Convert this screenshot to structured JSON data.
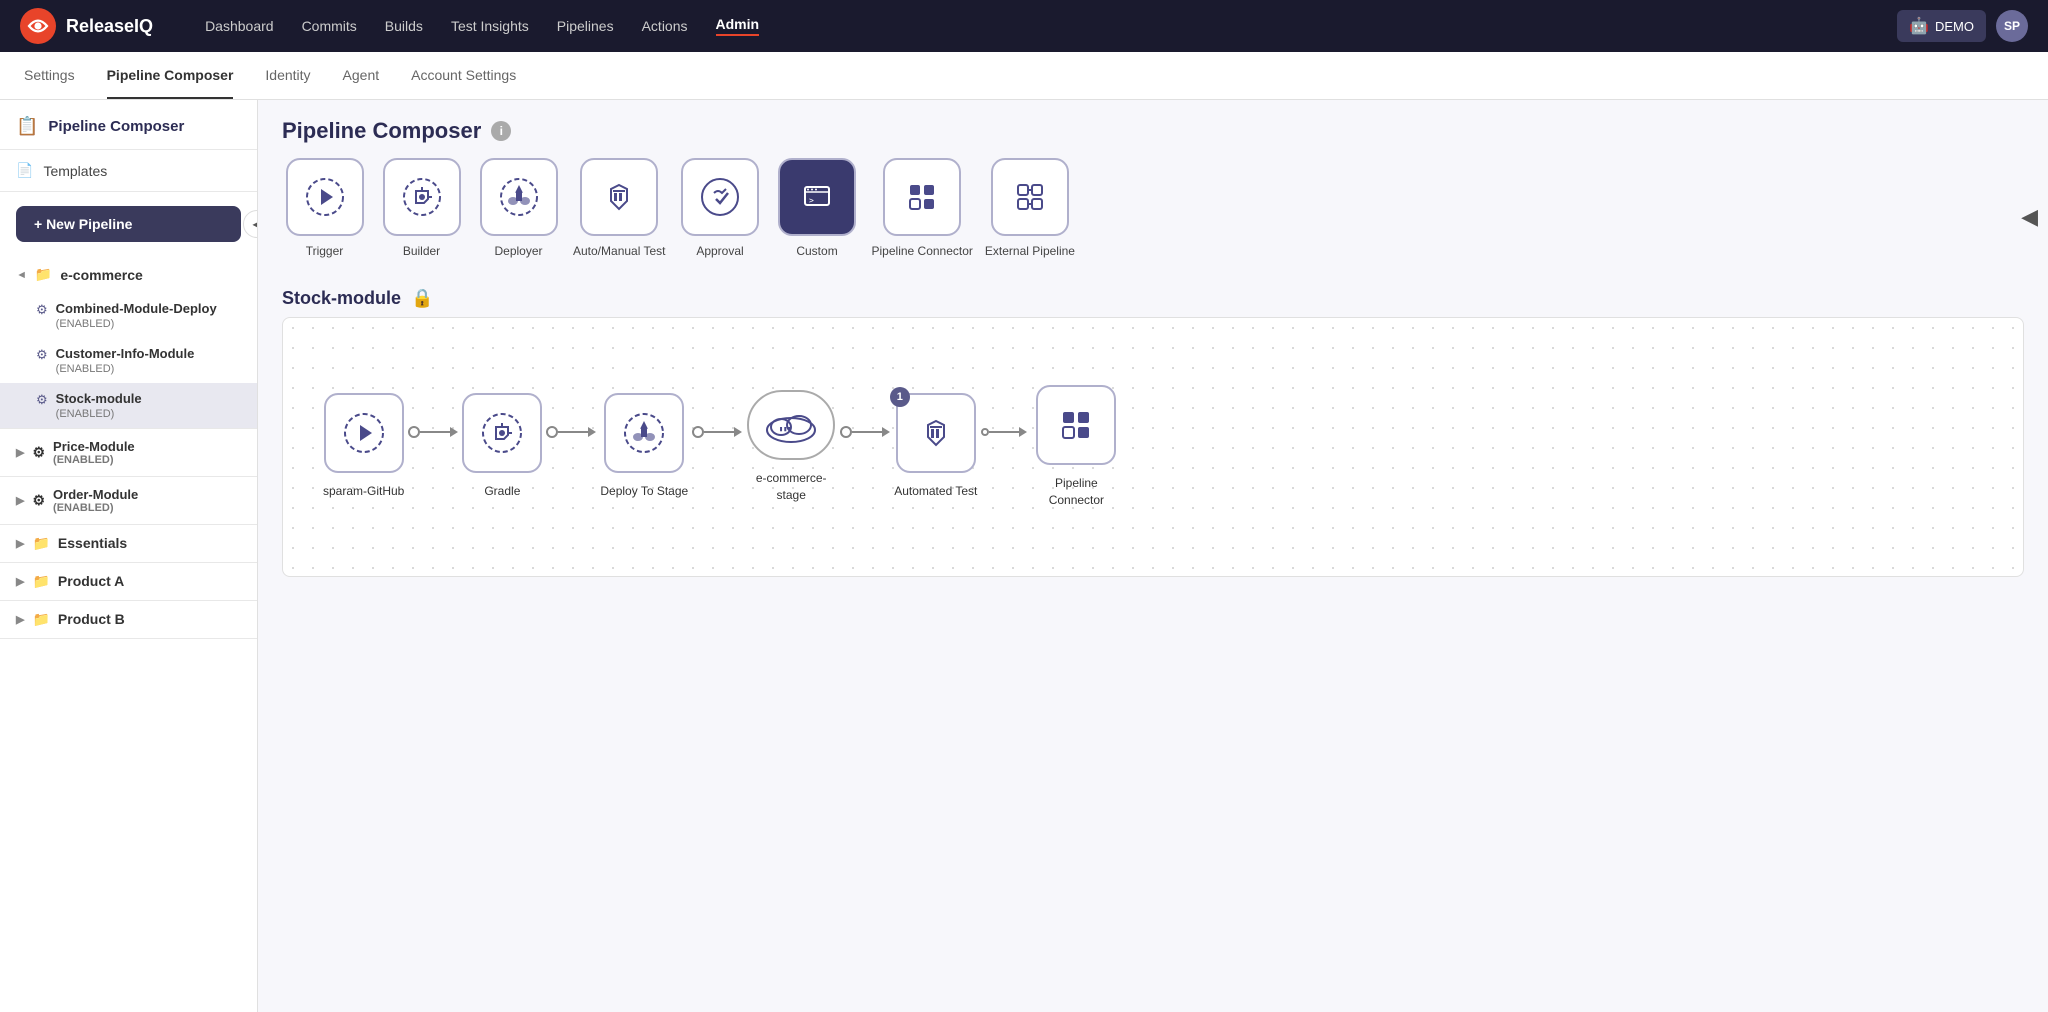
{
  "brand": {
    "name": "ReleaseIQ"
  },
  "topNav": {
    "links": [
      {
        "label": "Dashboard",
        "active": false
      },
      {
        "label": "Commits",
        "active": false
      },
      {
        "label": "Builds",
        "active": false
      },
      {
        "label": "Test Insights",
        "active": false
      },
      {
        "label": "Pipelines",
        "active": false
      },
      {
        "label": "Actions",
        "active": false
      },
      {
        "label": "Admin",
        "active": true
      }
    ],
    "demo_label": "DEMO",
    "avatar_label": "SP"
  },
  "subNav": {
    "items": [
      {
        "label": "Settings",
        "active": false
      },
      {
        "label": "Pipeline Composer",
        "active": true
      },
      {
        "label": "Identity",
        "active": false
      },
      {
        "label": "Agent",
        "active": false
      },
      {
        "label": "Account Settings",
        "active": false
      }
    ]
  },
  "sidebar": {
    "title": "Pipeline Composer",
    "templates_label": "Templates",
    "new_pipeline_label": "+ New Pipeline",
    "groups": [
      {
        "name": "e-commerce",
        "open": true,
        "pipelines": [
          {
            "name": "Combined-Module-Deploy",
            "status": "(ENABLED)",
            "active": false
          },
          {
            "name": "Customer-Info-Module",
            "status": "(ENABLED)",
            "active": false
          },
          {
            "name": "Stock-module",
            "status": "(ENABLED)",
            "active": true
          }
        ]
      },
      {
        "name": "Price-Module",
        "status": "(ENABLED)",
        "open": false,
        "pipelines": []
      },
      {
        "name": "Order-Module",
        "status": "(ENABLED)",
        "open": false,
        "pipelines": []
      },
      {
        "name": "Essentials",
        "open": false,
        "pipelines": []
      },
      {
        "name": "Product A",
        "open": false,
        "pipelines": []
      },
      {
        "name": "Product B",
        "open": false,
        "pipelines": []
      }
    ]
  },
  "content": {
    "title": "Pipeline Composer",
    "pipeline_name": "Stock-module",
    "stageIcons": [
      {
        "label": "Trigger",
        "icon": "⚡"
      },
      {
        "label": "Builder",
        "icon": "⚙"
      },
      {
        "label": "Deployer",
        "icon": "🚀"
      },
      {
        "label": "Auto/Manual Test",
        "icon": "🧪"
      },
      {
        "label": "Approval",
        "icon": "✅"
      },
      {
        "label": "Custom",
        "icon": "💻"
      },
      {
        "label": "Pipeline Connector",
        "icon": "🔲"
      },
      {
        "label": "External Pipeline",
        "icon": "⊞"
      }
    ],
    "pipelineNodes": [
      {
        "label": "sparam-GitHub",
        "icon": "trigger",
        "badge": null
      },
      {
        "label": "Gradle",
        "icon": "builder",
        "badge": null
      },
      {
        "label": "Deploy To Stage",
        "icon": "deployer",
        "badge": null
      },
      {
        "label": "e-commerce-stage",
        "icon": "cloud",
        "badge": null
      },
      {
        "label": "Automated Test",
        "icon": "test",
        "badge": "1"
      },
      {
        "label": "Pipeline Connector",
        "icon": "connector",
        "badge": null
      }
    ]
  }
}
